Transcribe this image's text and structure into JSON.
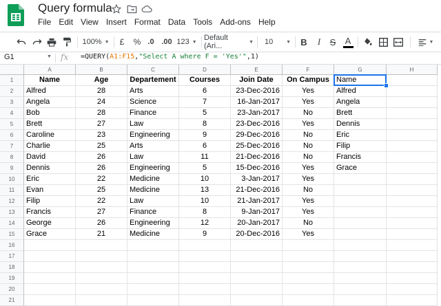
{
  "app": {
    "title": "Query formula",
    "menu": [
      "File",
      "Edit",
      "View",
      "Insert",
      "Format",
      "Data",
      "Tools",
      "Add-ons",
      "Help"
    ]
  },
  "toolbar": {
    "zoom": "100%",
    "currency": "£",
    "percent": "%",
    "decrease_decimal": ".0",
    "increase_decimal": ".00",
    "more_formats": "123",
    "font": "Default (Ari...",
    "font_size": "10",
    "bold": "B",
    "italic": "I",
    "strike": "S",
    "text_color": "A"
  },
  "formula_bar": {
    "name_box": "G1",
    "fx": "fx",
    "formula_prefix": "=QUERY(",
    "formula_range": "A1:F15",
    "formula_mid": ",",
    "formula_string": "\"Select A where F = 'Yes'\"",
    "formula_suffix": ",1)"
  },
  "sheet": {
    "columns": [
      "A",
      "B",
      "C",
      "D",
      "E",
      "F",
      "G",
      "H"
    ],
    "row_numbers": [
      "1",
      "2",
      "3",
      "4",
      "5",
      "6",
      "7",
      "8",
      "9",
      "10",
      "11",
      "12",
      "13",
      "14",
      "15",
      "16",
      "17",
      "18",
      "19",
      "20",
      "21"
    ],
    "headers": [
      "Name",
      "Age",
      "Departement",
      "Courses",
      "Join Date",
      "On Campus"
    ],
    "rows": [
      [
        "Alfred",
        "28",
        "Arts",
        "6",
        "23-Dec-2016",
        "Yes"
      ],
      [
        "Angela",
        "24",
        "Science",
        "7",
        "16-Jan-2017",
        "Yes"
      ],
      [
        "Bob",
        "28",
        "Finance",
        "5",
        "23-Jan-2017",
        "No"
      ],
      [
        "Brett",
        "27",
        "Law",
        "8",
        "23-Dec-2016",
        "Yes"
      ],
      [
        "Caroline",
        "23",
        "Engineering",
        "9",
        "29-Dec-2016",
        "No"
      ],
      [
        "Charlie",
        "25",
        "Arts",
        "6",
        "25-Dec-2016",
        "No"
      ],
      [
        "David",
        "26",
        "Law",
        "11",
        "21-Dec-2016",
        "No"
      ],
      [
        "Dennis",
        "26",
        "Engineering",
        "5",
        "15-Dec-2016",
        "Yes"
      ],
      [
        "Eric",
        "22",
        "Medicine",
        "10",
        "3-Jan-2017",
        "Yes"
      ],
      [
        "Evan",
        "25",
        "Medicine",
        "13",
        "21-Dec-2016",
        "No"
      ],
      [
        "Filip",
        "22",
        "Law",
        "10",
        "21-Jan-2017",
        "Yes"
      ],
      [
        "Francis",
        "27",
        "Finance",
        "8",
        "9-Jan-2017",
        "Yes"
      ],
      [
        "George",
        "26",
        "Engineering",
        "12",
        "20-Jan-2017",
        "No"
      ],
      [
        "Grace",
        "21",
        "Medicine",
        "9",
        "20-Dec-2016",
        "Yes"
      ]
    ],
    "query_result": [
      "Name",
      "Alfred",
      "Angela",
      "Brett",
      "Dennis",
      "Eric",
      "Filip",
      "Francis",
      "Grace"
    ]
  },
  "colors": {
    "brand_green": "#0f9d58",
    "selection_blue": "#1a73e8"
  },
  "icons": [
    "undo-icon",
    "redo-icon",
    "print-icon",
    "paint-format-icon",
    "star-icon",
    "move-folder-icon",
    "cloud-status-icon",
    "fill-color-icon",
    "borders-icon",
    "merge-cells-icon",
    "align-left-icon"
  ]
}
